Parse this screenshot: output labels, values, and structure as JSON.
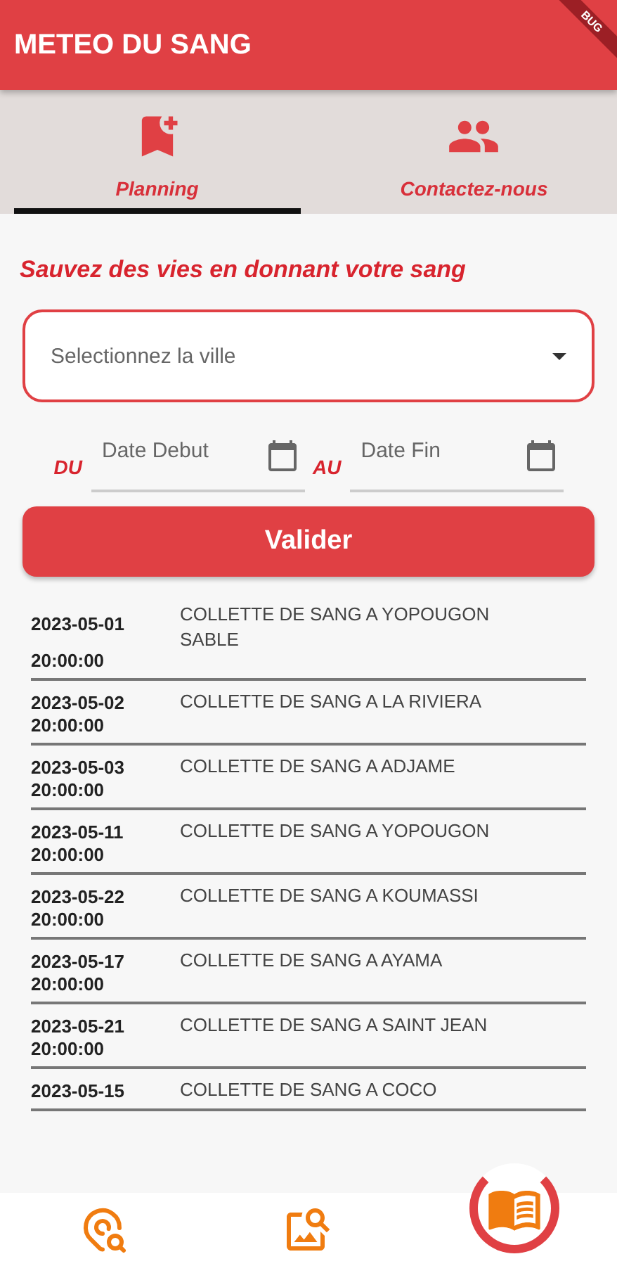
{
  "app_bar": {
    "title": "METEO DU SANG",
    "debug_banner": "BUG"
  },
  "tabs": [
    {
      "label": "Planning",
      "selected": true
    },
    {
      "label": "Contactez-nous",
      "selected": false
    }
  ],
  "heading": "Sauvez des vies en donnant votre sang",
  "city_select": {
    "placeholder": "Selectionnez la ville"
  },
  "date_range": {
    "from_label": "DU",
    "from_placeholder": "Date Debut",
    "to_label": "AU",
    "to_placeholder": "Date Fin"
  },
  "submit_button": "Valider",
  "events": [
    {
      "date": "2023-05-01",
      "time": "20:00:00",
      "title": "COLLETTE DE SANG A YOPOUGON SABLE"
    },
    {
      "date": "2023-05-02",
      "time": "20:00:00",
      "title": "COLLETTE DE SANG A LA RIVIERA"
    },
    {
      "date": "2023-05-03",
      "time": "20:00:00",
      "title": "COLLETTE DE SANG A ADJAME"
    },
    {
      "date": "2023-05-11",
      "time": "20:00:00",
      "title": "COLLETTE DE SANG A YOPOUGON"
    },
    {
      "date": "2023-05-22",
      "time": "20:00:00",
      "title": "COLLETTE DE SANG A KOUMASSI"
    },
    {
      "date": "2023-05-17",
      "time": "20:00:00",
      "title": "COLLETTE DE SANG A AYAMA"
    },
    {
      "date": "2023-05-21",
      "time": "20:00:00",
      "title": "COLLETTE DE SANG A SAINT JEAN"
    },
    {
      "date": "2023-05-15",
      "title": "COLLETTE DE SANG A COCO"
    }
  ],
  "bottom_nav": [
    {
      "selected": false
    },
    {
      "selected": false
    },
    {
      "selected": true
    }
  ]
}
